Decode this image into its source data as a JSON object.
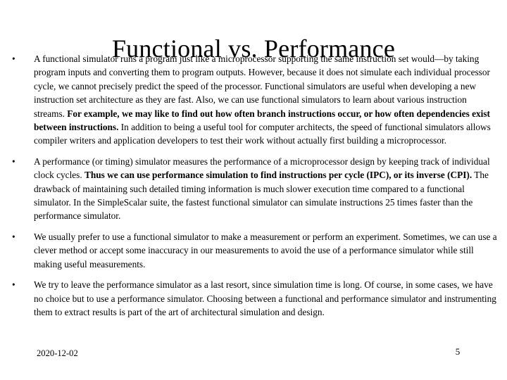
{
  "slide": {
    "title": "Functional vs. Performance",
    "bullet_marker": "•",
    "bullets": [
      {
        "runs": [
          {
            "text": "A functional simulator runs a program just like a microprocessor supporting the same instruction set would—by taking program inputs and converting them to program outputs. However, because it does not simulate each individual processor cycle, we cannot precisely predict the speed of the processor. Functional simulators are useful when developing a new instruction set architecture as they are fast. Also, we can use functional simulators to learn about various instruction streams. ",
            "bold": false
          },
          {
            "text": "For example, we may like to find out how often branch instructions occur, or how often dependencies exist between instructions.",
            "bold": true
          },
          {
            "text": " In addition to being a useful tool for computer architects, the speed of functional simulators allows compiler writers and application developers to test their work without actually first building a microprocessor.",
            "bold": false
          }
        ]
      },
      {
        "runs": [
          {
            "text": "A performance (or timing) simulator measures the performance of a microprocessor design by keeping track of individual clock cycles. ",
            "bold": false
          },
          {
            "text": "Thus we can use performance simulation to find instructions per cycle (IPC), or its inverse (CPI).",
            "bold": true
          },
          {
            "text": " The drawback of maintaining such detailed timing information is much slower execution time compared to a functional simulator. In the SimpleScalar suite, the fastest functional simulator can simulate instructions 25 times faster than the performance simulator.",
            "bold": false
          }
        ]
      },
      {
        "runs": [
          {
            "text": "We usually prefer to use a functional simulator to make a measurement or perform an experiment. Sometimes, we can use a clever method or accept some inaccuracy in our measurements to avoid the use of a performance simulator while still making useful measurements.",
            "bold": false
          }
        ]
      },
      {
        "runs": [
          {
            "text": "We try to leave the performance simulator as a last resort, since simulation time is long. Of course, in some cases, we have no choice but to use a performance simulator. Choosing between a functional and performance simulator and instrumenting them to extract results is part of the art of architectural simulation and design.",
            "bold": false
          }
        ]
      }
    ]
  },
  "footer": {
    "date": "2020-12-02",
    "page_number": "5"
  }
}
